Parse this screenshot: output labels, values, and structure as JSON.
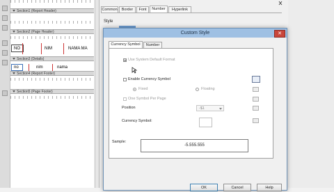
{
  "designer": {
    "bands": [
      {
        "label": "Section1 (Report Header)"
      },
      {
        "label": "Section2 (Page Header)"
      },
      {
        "label": "Section3 (Details)"
      },
      {
        "label": "Section4 (Report Footer)"
      },
      {
        "label": "Section5 (Page Footer)"
      }
    ],
    "header_cells": [
      "NO",
      "NIM",
      "NAMA MA"
    ],
    "detail_cells": [
      "no",
      "nim",
      "nama"
    ]
  },
  "format_dialog": {
    "tabs": [
      "Common",
      "Border",
      "Font",
      "Number",
      "Hyperlink"
    ],
    "active_tab": "Number",
    "style_label": "Style"
  },
  "modal": {
    "title": "Custom Style",
    "close_glyph": "✕",
    "tabs": [
      "Currency Symbol",
      "Number"
    ],
    "active_tab": "Currency Symbol",
    "use_system_default": "Use System Default Format",
    "enable_currency": "Enable Currency Symbol",
    "fixed": "Fixed",
    "floating": "Floating",
    "one_symbol": "One Symbol Per Page",
    "position_label": "Position",
    "position_value": "-$1",
    "currency_symbol_label": "Currency Symbol:",
    "sample_label": "Sample:",
    "sample_value": "-5.555.555",
    "ok": "OK",
    "cancel": "Cancel",
    "help": "Help"
  },
  "colors": {
    "title_bar": "#9fc0e3",
    "close_button": "#c9463b",
    "band_header": "#d8d8d8"
  }
}
